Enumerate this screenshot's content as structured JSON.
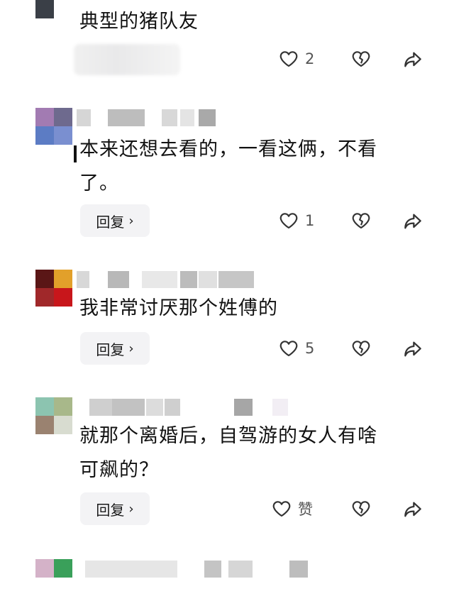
{
  "comments": [
    {
      "text": "典型的猪队友",
      "like_count": "2"
    },
    {
      "text_line1": "本来还想去看的，一看这俩，不看",
      "text_line2": "了。",
      "reply_label": "回复",
      "like_count": "1"
    },
    {
      "text": "我非常讨厌那个姓傅的",
      "reply_label": "回复",
      "like_count": "5"
    },
    {
      "text_line1": "就那个离婚后，自驾游的女人有啥",
      "text_line2": "可飙的？",
      "reply_label": "回复",
      "like_label": "赞"
    }
  ],
  "icons": {
    "like": "heart-icon",
    "dislike": "broken-heart-icon",
    "share": "share-arrow-icon",
    "reply_chevron": "chevron-right-icon"
  },
  "colors": {
    "icon_stroke": "#333333",
    "reply_bg": "#f3f3f5",
    "count": "#555555"
  }
}
